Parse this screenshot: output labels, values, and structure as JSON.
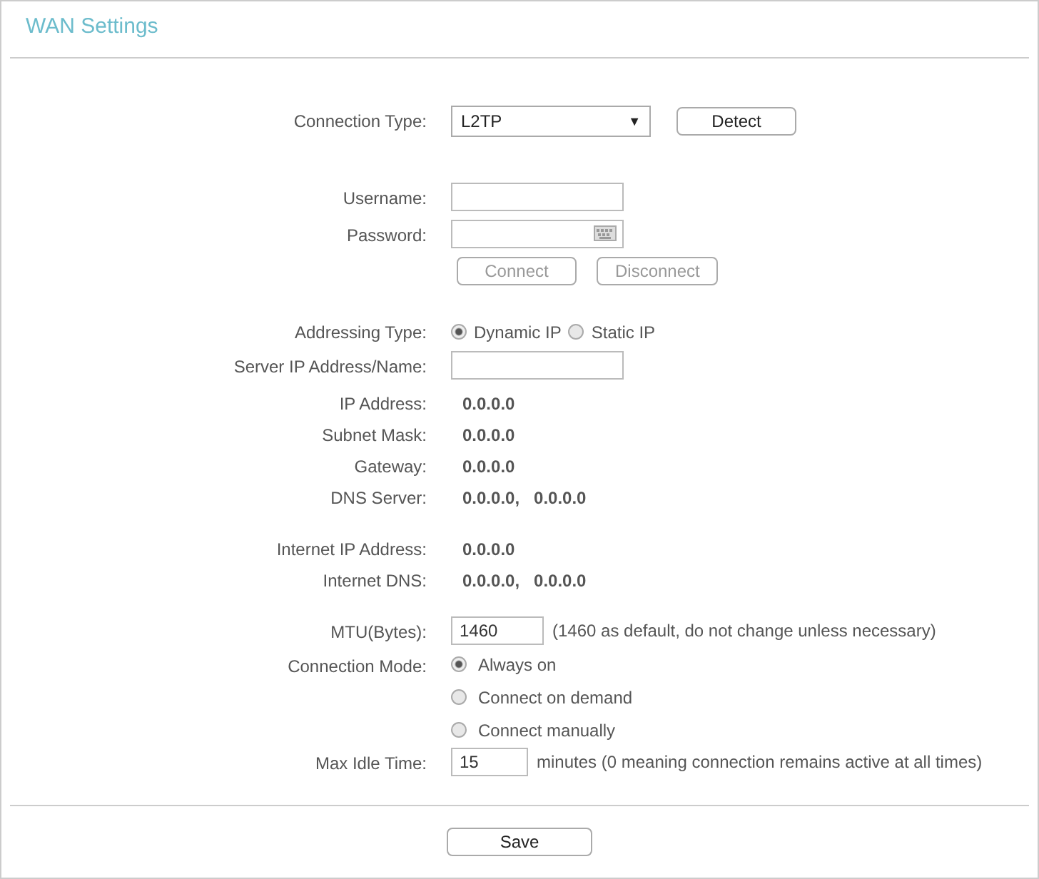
{
  "title": "WAN Settings",
  "sections": [
    [
      {
        "kind": "select",
        "label": "Connection Type:",
        "value": "L2TP",
        "arrow": "▼",
        "button": {
          "label": "Detect",
          "disabled": false
        }
      }
    ],
    [
      {
        "kind": "input",
        "label": "Username:"
      },
      {
        "kind": "password",
        "label": "Password:"
      },
      {
        "kind": "buttons",
        "buttons": [
          {
            "label": "Connect",
            "disabled": true
          },
          {
            "label": "Disconnect",
            "disabled": true
          }
        ]
      }
    ],
    [
      {
        "kind": "radio_inline",
        "label": "Addressing Type:",
        "options": [
          {
            "label": "Dynamic IP",
            "selected": true
          },
          {
            "label": "Static IP",
            "selected": false
          }
        ]
      },
      {
        "kind": "input",
        "label": "Server IP Address/Name:"
      },
      {
        "kind": "static",
        "label": "IP Address:",
        "values": [
          "0.0.0.0"
        ]
      },
      {
        "kind": "static",
        "label": "Subnet Mask:",
        "values": [
          "0.0.0.0"
        ]
      },
      {
        "kind": "static",
        "label": "Gateway:",
        "values": [
          "0.0.0.0"
        ]
      },
      {
        "kind": "static",
        "label": "DNS Server:",
        "values": [
          "0.0.0.0,",
          "0.0.0.0"
        ]
      }
    ],
    [
      {
        "kind": "static",
        "label": "Internet IP Address:",
        "values": [
          "0.0.0.0"
        ]
      },
      {
        "kind": "static",
        "label": "Internet DNS:",
        "values": [
          "0.0.0.0,",
          "0.0.0.0"
        ]
      }
    ],
    [
      {
        "kind": "input_note",
        "label": "MTU(Bytes):",
        "value": "1460",
        "note": "(1460 as default, do not change unless necessary)"
      },
      {
        "kind": "radio_stack",
        "label": "Connection Mode:",
        "options": [
          {
            "label": "Always on",
            "selected": true
          },
          {
            "label": "Connect on demand",
            "selected": false
          },
          {
            "label": "Connect manually",
            "selected": false
          }
        ]
      },
      {
        "kind": "input_note",
        "label": "Max Idle Time:",
        "value": "15",
        "note": "minutes (0 meaning connection remains active at all times)"
      }
    ]
  ],
  "save": "Save"
}
